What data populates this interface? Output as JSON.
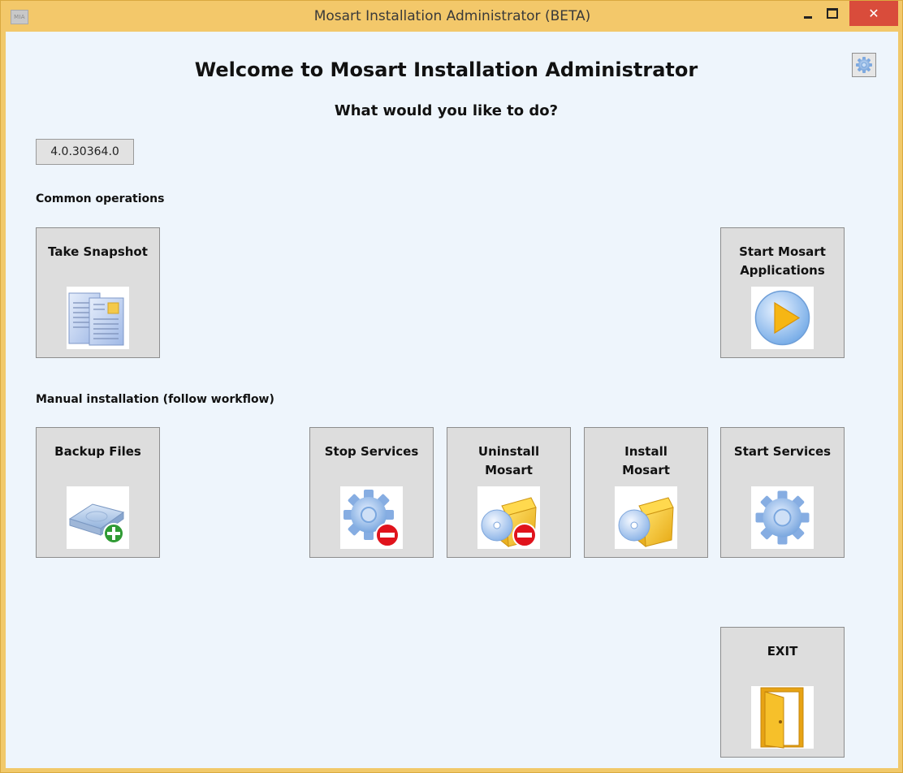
{
  "window": {
    "app_icon_text": "MIA",
    "title": "Mosart Installation Administrator (BETA)",
    "close_glyph": "✕"
  },
  "header": {
    "welcome": "Welcome to Mosart Installation Administrator",
    "subtitle": "What would you like to do?",
    "settings_icon": "gear-icon"
  },
  "version": "4.0.30364.0",
  "sections": {
    "common": "Common operations",
    "manual": "Manual installation (follow workflow)"
  },
  "tiles": {
    "take_snapshot": {
      "label": "Take Snapshot",
      "icon": "snapshot-documents-icon"
    },
    "start_mosart_applications": {
      "label": "Start Mosart\nApplications",
      "icon": "play-icon"
    },
    "backup_files": {
      "label": "Backup Files",
      "icon": "disk-add-icon"
    },
    "stop_services": {
      "label": "Stop Services",
      "icon": "gear-stop-icon"
    },
    "uninstall_mosart": {
      "label": "Uninstall\nMosart",
      "icon": "package-remove-icon"
    },
    "install_mosart": {
      "label": "Install\nMosart",
      "icon": "package-install-icon"
    },
    "start_services": {
      "label": "Start Services",
      "icon": "gear-icon"
    },
    "exit": {
      "label": "EXIT",
      "icon": "door-exit-icon"
    }
  },
  "colors": {
    "window_frame": "#f3c86a",
    "client_background": "#eef5fc",
    "tile_background": "#dddddd",
    "close_button": "#d94c3b"
  }
}
